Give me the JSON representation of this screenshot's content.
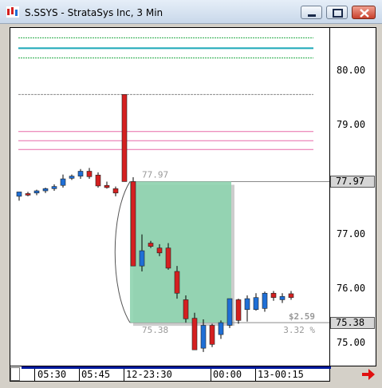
{
  "window": {
    "title": "S.SSYS - StrataSys Inc, 3 Min"
  },
  "price_axis": {
    "ticks": [
      "80.00",
      "79.00",
      "77.00",
      "76.00",
      "75.00"
    ],
    "highlight_upper": "77.97",
    "highlight_lower": "75.38"
  },
  "time_axis": {
    "labels": [
      "05:30",
      "05:45",
      "12-23:30",
      "00:00",
      "13-00:15"
    ]
  },
  "measure": {
    "top_price": "77.97",
    "bottom_price": "75.38",
    "change": "$2.59",
    "percent": "3.32 %"
  },
  "colors": {
    "up": "#1f6fd6",
    "down": "#d42020",
    "measure_fill": "#8fd4b0",
    "green_line": "#22aa44",
    "teal_line": "#1aa7b8",
    "pink_line": "#e86aa8",
    "gray_line": "#8a8a8a"
  },
  "chart_data": {
    "type": "candlestick",
    "symbol": "S.SSYS",
    "interval": "3 Min",
    "y_range": [
      74.7,
      80.75
    ],
    "candles": [
      {
        "o": 77.7,
        "h": 77.78,
        "l": 77.62,
        "c": 77.78
      },
      {
        "o": 77.75,
        "h": 77.78,
        "l": 77.7,
        "c": 77.74
      },
      {
        "o": 77.76,
        "h": 77.82,
        "l": 77.72,
        "c": 77.8
      },
      {
        "o": 77.8,
        "h": 77.86,
        "l": 77.76,
        "c": 77.84
      },
      {
        "o": 77.84,
        "h": 77.92,
        "l": 77.8,
        "c": 77.88
      },
      {
        "o": 77.9,
        "h": 78.1,
        "l": 77.86,
        "c": 78.02
      },
      {
        "o": 78.03,
        "h": 78.1,
        "l": 78.0,
        "c": 78.07
      },
      {
        "o": 78.07,
        "h": 78.2,
        "l": 78.02,
        "c": 78.16
      },
      {
        "o": 78.16,
        "h": 78.22,
        "l": 78.02,
        "c": 78.06
      },
      {
        "o": 78.09,
        "h": 78.14,
        "l": 77.86,
        "c": 77.89
      },
      {
        "o": 77.9,
        "h": 77.97,
        "l": 77.84,
        "c": 77.86
      },
      {
        "o": 77.84,
        "h": 77.88,
        "l": 77.7,
        "c": 77.76
      },
      {
        "o": 79.57,
        "h": 79.57,
        "l": 77.97,
        "c": 77.97
      },
      {
        "o": 77.97,
        "h": 78.05,
        "l": 76.42,
        "c": 76.42
      },
      {
        "o": 76.42,
        "h": 77.0,
        "l": 76.32,
        "c": 76.7
      },
      {
        "o": 76.84,
        "h": 76.88,
        "l": 76.75,
        "c": 76.78
      },
      {
        "o": 76.75,
        "h": 76.82,
        "l": 76.6,
        "c": 76.66
      },
      {
        "o": 76.75,
        "h": 76.84,
        "l": 76.35,
        "c": 76.38
      },
      {
        "o": 76.32,
        "h": 76.42,
        "l": 75.82,
        "c": 75.92
      },
      {
        "o": 75.8,
        "h": 75.88,
        "l": 75.38,
        "c": 75.45
      },
      {
        "o": 75.46,
        "h": 75.56,
        "l": 74.88,
        "c": 74.88
      },
      {
        "o": 74.91,
        "h": 75.44,
        "l": 74.84,
        "c": 75.33
      },
      {
        "o": 75.33,
        "h": 75.36,
        "l": 74.93,
        "c": 74.98
      },
      {
        "o": 75.16,
        "h": 75.42,
        "l": 75.08,
        "c": 75.38
      },
      {
        "o": 75.33,
        "h": 75.82,
        "l": 75.28,
        "c": 75.82
      },
      {
        "o": 75.8,
        "h": 75.82,
        "l": 75.36,
        "c": 75.42
      },
      {
        "o": 75.62,
        "h": 75.88,
        "l": 75.4,
        "c": 75.82
      },
      {
        "o": 75.62,
        "h": 75.92,
        "l": 75.6,
        "c": 75.84
      },
      {
        "o": 75.64,
        "h": 75.95,
        "l": 75.58,
        "c": 75.92
      },
      {
        "o": 75.92,
        "h": 75.96,
        "l": 75.78,
        "c": 75.84
      },
      {
        "o": 75.8,
        "h": 75.92,
        "l": 75.74,
        "c": 75.86
      },
      {
        "o": 75.91,
        "h": 75.96,
        "l": 75.8,
        "c": 75.84
      }
    ],
    "horizontal_lines": [
      {
        "price": 80.61,
        "color": "green"
      },
      {
        "price": 80.42,
        "color": "teal"
      },
      {
        "price": 80.24,
        "color": "green"
      },
      {
        "price": 79.57,
        "color": "gray"
      },
      {
        "price": 78.89,
        "color": "pink"
      },
      {
        "price": 78.72,
        "color": "pink"
      },
      {
        "price": 78.56,
        "color": "pink"
      },
      {
        "price": 77.97,
        "color": "gray"
      },
      {
        "price": 75.38,
        "color": "gray"
      }
    ],
    "measure_box": {
      "from_price": 77.97,
      "to_price": 75.38
    },
    "grid": false
  }
}
